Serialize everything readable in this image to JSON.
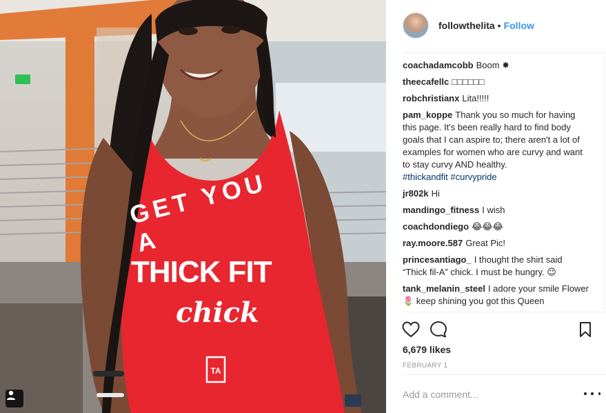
{
  "post": {
    "username": "followthelita",
    "separator": "•",
    "follow_label": "Follow",
    "shirt_lines": [
      "GET YOU A",
      "THICK FIT",
      "chick"
    ],
    "comments": [
      {
        "user": "coachadamcobb",
        "text": "Boom ✸"
      },
      {
        "user": "theecafellc",
        "text": "□□□□□□"
      },
      {
        "user": "robchristianx",
        "text": "Lita!!!!!"
      },
      {
        "user": "pam_koppe",
        "text": "Thank you so much for having this page. It's been really hard to find body goals that I can aspire to; there aren't a lot of examples for women who are curvy and want to stay curvy AND healthy.",
        "tags": "#thickandfit #curvypride"
      },
      {
        "user": "jr802k",
        "text": "Hi"
      },
      {
        "user": "mandingo_fitness",
        "text": "I wish"
      },
      {
        "user": "coachdondiego",
        "text": "😂😂😂"
      },
      {
        "user": "ray.moore.587",
        "text": "Great Pic!"
      },
      {
        "user": "princesantiago_",
        "text": "I thought the shirt said “Thick fil-A” chick. I must be hungry. 😉"
      },
      {
        "user": "tank_melanin_steel",
        "text": "I adore your smile Flower 🌷 keep shining you got this Queen"
      }
    ],
    "likes": "6,679 likes",
    "date": "FEBRUARY 1",
    "add_comment_placeholder": "Add a comment..."
  },
  "icons": {
    "like": "heart-icon",
    "comment": "comment-bubble-icon",
    "save": "bookmark-icon",
    "tag": "user-tag-icon",
    "more": "more-options-icon"
  },
  "colors": {
    "follow_blue": "#3897f0",
    "hashtag": "#003569",
    "shirt_red": "#e8262f",
    "muted": "#999999"
  }
}
